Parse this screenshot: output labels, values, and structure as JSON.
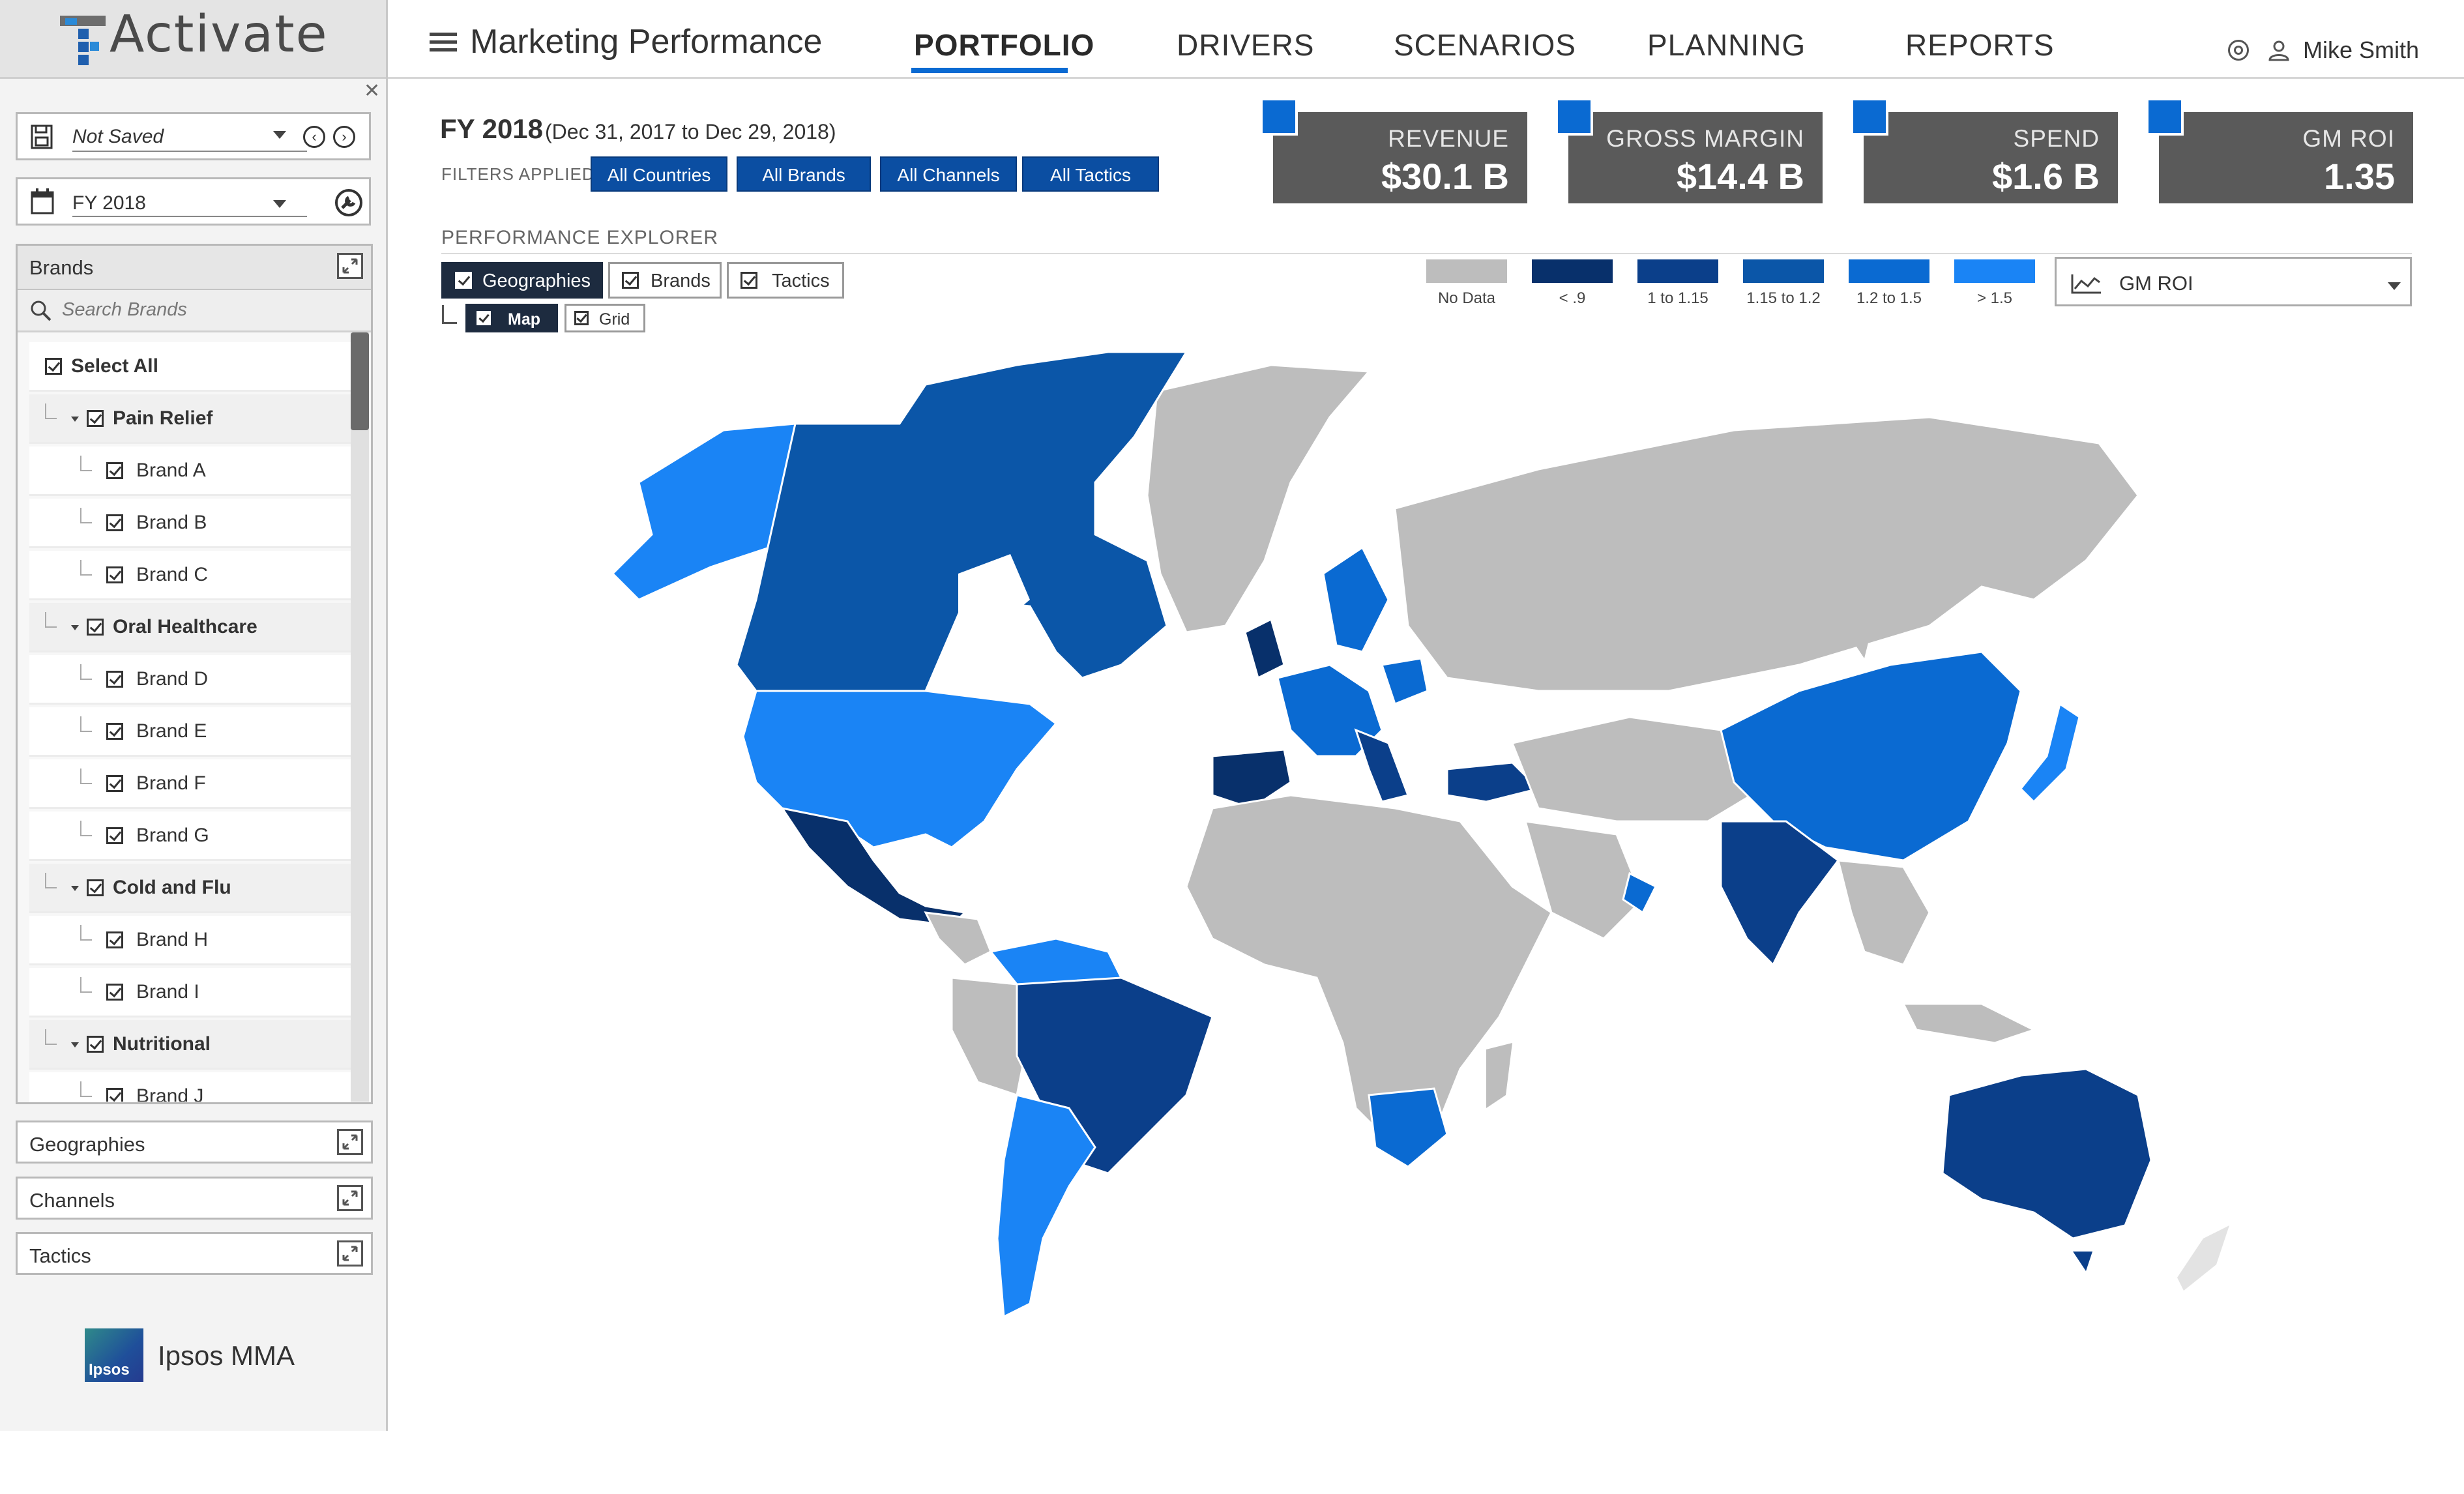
{
  "app": {
    "logo_text": "Activate",
    "section_title": "Marketing Performance"
  },
  "nav": {
    "tabs": [
      {
        "label": "PORTFOLIO",
        "active": true
      },
      {
        "label": "DRIVERS",
        "active": false
      },
      {
        "label": "SCENARIOS",
        "active": false
      },
      {
        "label": "PLANNING",
        "active": false
      },
      {
        "label": "REPORTS",
        "active": false
      }
    ],
    "user_name": "Mike Smith",
    "icons": [
      "menu-icon",
      "help-icon",
      "user-icon"
    ]
  },
  "sidebar": {
    "scenario_select": {
      "value": "Not Saved"
    },
    "period_select": {
      "value": "FY 2018"
    },
    "brands": {
      "title": "Brands",
      "search_placeholder": "Search Brands",
      "select_all_label": "Select All",
      "tree": [
        {
          "label": "Pain Relief",
          "type": "group"
        },
        {
          "label": "Brand A",
          "type": "item"
        },
        {
          "label": "Brand B",
          "type": "item"
        },
        {
          "label": "Brand C",
          "type": "item"
        },
        {
          "label": "Oral Healthcare",
          "type": "group"
        },
        {
          "label": "Brand D",
          "type": "item"
        },
        {
          "label": "Brand E",
          "type": "item"
        },
        {
          "label": "Brand F",
          "type": "item"
        },
        {
          "label": "Brand G",
          "type": "item"
        },
        {
          "label": "Cold and Flu",
          "type": "group"
        },
        {
          "label": "Brand H",
          "type": "item"
        },
        {
          "label": "Brand I",
          "type": "item"
        },
        {
          "label": "Nutritional",
          "type": "group"
        },
        {
          "label": "Brand J",
          "type": "item"
        }
      ]
    },
    "panels": [
      "Geographies",
      "Channels",
      "Tactics"
    ],
    "footer_brand": {
      "badge": "Ipsos",
      "name": "Ipsos MMA"
    }
  },
  "main": {
    "period_title": "FY 2018",
    "period_range": "(Dec 31, 2017 to Dec 29, 2018)",
    "filters_label": "FILTERS APPLIED:",
    "filters": [
      "All Countries",
      "All Brands",
      "All Channels",
      "All Tactics"
    ],
    "kpis": [
      {
        "label": "REVENUE",
        "value": "$30.1 B"
      },
      {
        "label": "GROSS MARGIN",
        "value": "$14.4 B"
      },
      {
        "label": "SPEND",
        "value": "$1.6 B"
      },
      {
        "label": "GM ROI",
        "value": "1.35"
      }
    ],
    "explorer": {
      "title": "PERFORMANCE EXPLORER",
      "dimension_toggles": [
        {
          "label": "Geographies",
          "checked": true
        },
        {
          "label": "Brands",
          "checked": false
        },
        {
          "label": "Tactics",
          "checked": false
        }
      ],
      "view_toggles": [
        {
          "label": "Map",
          "checked": true
        },
        {
          "label": "Grid",
          "checked": false
        }
      ],
      "metric_select": {
        "value": "GM ROI"
      }
    },
    "legend": [
      {
        "label": "No Data",
        "color": "#bdbdbd"
      },
      {
        "label": "< .9",
        "color": "#08306b"
      },
      {
        "label": "1 to 1.15",
        "color": "#0b3f8a"
      },
      {
        "label": "1.15 to 1.2",
        "color": "#0b56a8"
      },
      {
        "label": "1.2 to 1.5",
        "color": "#0a6ad2"
      },
      {
        "label": "> 1.5",
        "color": "#1a84f5"
      }
    ]
  }
}
